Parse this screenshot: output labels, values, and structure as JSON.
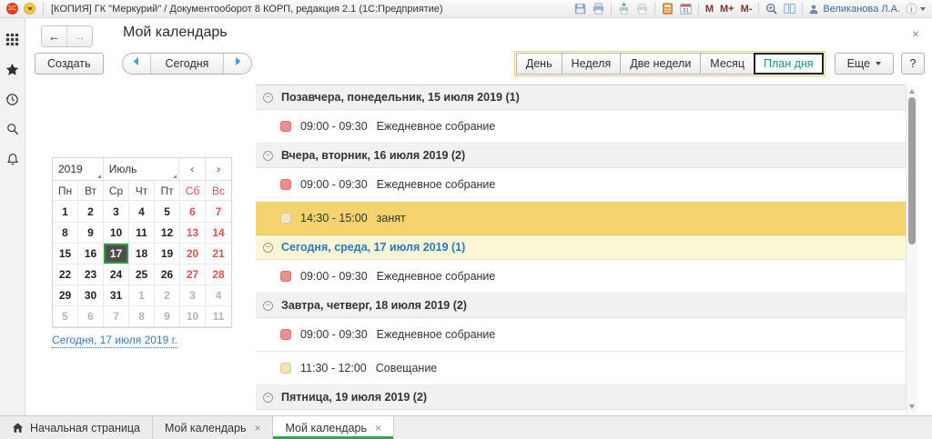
{
  "titlebar": {
    "title": "[КОПИЯ] ГК \"Меркурий\" / Документооборот 8 КОРП, редакция 2.1   (1С:Предприятие)",
    "user": "Великанова Л.А.",
    "tools": [
      {
        "name": "save-icon"
      },
      {
        "name": "print-icon"
      },
      {
        "name": "print-settings-icon"
      },
      {
        "name": "print-preview-icon"
      },
      {
        "name": "calculator-icon"
      },
      {
        "name": "calendar-icon"
      },
      {
        "name": "memory-recall-button",
        "label": "M"
      },
      {
        "name": "memory-plus-button",
        "label": "M+"
      },
      {
        "name": "memory-minus-button",
        "label": "M-"
      },
      {
        "name": "zoom-icon"
      },
      {
        "name": "split-view-icon"
      }
    ]
  },
  "sidebar": {
    "items": [
      {
        "name": "menu-grid-icon"
      },
      {
        "name": "favorites-star-icon"
      },
      {
        "name": "history-icon"
      },
      {
        "name": "search-icon"
      },
      {
        "name": "notifications-bell-icon"
      }
    ]
  },
  "header": {
    "title": "Мой календарь",
    "back": "←",
    "forward": "→",
    "close": "×"
  },
  "toolbar": {
    "create": "Создать",
    "today": "Сегодня",
    "views": [
      "День",
      "Неделя",
      "Две недели",
      "Месяц",
      "План дня"
    ],
    "active_view": "План дня",
    "more": "Еще",
    "help": "?"
  },
  "calendar": {
    "year": "2019",
    "month": "Июль",
    "prev": "‹",
    "next": "›",
    "weekdays": [
      {
        "l": "Пн",
        "w": false
      },
      {
        "l": "Вт",
        "w": false
      },
      {
        "l": "Ср",
        "w": false
      },
      {
        "l": "Чт",
        "w": false
      },
      {
        "l": "Пт",
        "w": false
      },
      {
        "l": "Сб",
        "w": true
      },
      {
        "l": "Вс",
        "w": true
      }
    ],
    "weeks": [
      [
        {
          "d": "1",
          "t": "n"
        },
        {
          "d": "2",
          "t": "n"
        },
        {
          "d": "3",
          "t": "n"
        },
        {
          "d": "4",
          "t": "n"
        },
        {
          "d": "5",
          "t": "n"
        },
        {
          "d": "6",
          "t": "w"
        },
        {
          "d": "7",
          "t": "w"
        }
      ],
      [
        {
          "d": "8",
          "t": "n"
        },
        {
          "d": "9",
          "t": "n"
        },
        {
          "d": "10",
          "t": "n"
        },
        {
          "d": "11",
          "t": "n"
        },
        {
          "d": "12",
          "t": "n"
        },
        {
          "d": "13",
          "t": "w"
        },
        {
          "d": "14",
          "t": "w"
        }
      ],
      [
        {
          "d": "15",
          "t": "n"
        },
        {
          "d": "16",
          "t": "n"
        },
        {
          "d": "17",
          "t": "s"
        },
        {
          "d": "18",
          "t": "n"
        },
        {
          "d": "19",
          "t": "n"
        },
        {
          "d": "20",
          "t": "w"
        },
        {
          "d": "21",
          "t": "w"
        }
      ],
      [
        {
          "d": "22",
          "t": "n"
        },
        {
          "d": "23",
          "t": "n"
        },
        {
          "d": "24",
          "t": "n"
        },
        {
          "d": "25",
          "t": "n"
        },
        {
          "d": "26",
          "t": "n"
        },
        {
          "d": "27",
          "t": "w"
        },
        {
          "d": "28",
          "t": "w"
        }
      ],
      [
        {
          "d": "29",
          "t": "n"
        },
        {
          "d": "30",
          "t": "n"
        },
        {
          "d": "31",
          "t": "n"
        },
        {
          "d": "1",
          "t": "m"
        },
        {
          "d": "2",
          "t": "m"
        },
        {
          "d": "3",
          "t": "m"
        },
        {
          "d": "4",
          "t": "m"
        }
      ],
      [
        {
          "d": "5",
          "t": "m"
        },
        {
          "d": "6",
          "t": "m"
        },
        {
          "d": "7",
          "t": "m"
        },
        {
          "d": "8",
          "t": "m"
        },
        {
          "d": "9",
          "t": "m"
        },
        {
          "d": "10",
          "t": "m"
        },
        {
          "d": "11",
          "t": "m"
        }
      ]
    ],
    "today_link": "Сегодня, 17 июля 2019 г."
  },
  "agenda": {
    "groups": [
      {
        "title": "Позавчера, понедельник, 15 июля 2019",
        "count": "1",
        "today": false,
        "events": [
          {
            "time": "09:00 - 09:30",
            "title": "Ежедневное собрание",
            "color": "#f18c8c",
            "selected": false
          }
        ]
      },
      {
        "title": "Вчера, вторник, 16 июля 2019",
        "count": "2",
        "today": false,
        "events": [
          {
            "time": "09:00 - 09:30",
            "title": "Ежедневное собрание",
            "color": "#f18c8c",
            "selected": false
          },
          {
            "time": "14:30 - 15:00",
            "title": "занят",
            "color": "#f1e6c9",
            "selected": true
          }
        ]
      },
      {
        "title": "Сегодня, среда, 17 июля 2019",
        "count": "1",
        "today": true,
        "events": [
          {
            "time": "09:00 - 09:30",
            "title": "Ежедневное собрание",
            "color": "#f18c8c",
            "selected": false
          }
        ]
      },
      {
        "title": "Завтра, четверг, 18 июля 2019",
        "count": "2",
        "today": false,
        "events": [
          {
            "time": "09:00 - 09:30",
            "title": "Ежедневное собрание",
            "color": "#f18c8c",
            "selected": false
          },
          {
            "time": "11:30 - 12:00",
            "title": "Совещание",
            "color": "#f2e3b6",
            "selected": false
          }
        ]
      },
      {
        "title": "Пятница, 19 июля 2019",
        "count": "2",
        "today": false,
        "events": []
      }
    ]
  },
  "tabs": [
    {
      "label": "Начальная страница",
      "icon": "home-icon",
      "closable": false,
      "active": false,
      "close": "×"
    },
    {
      "label": "Мой календарь",
      "closable": true,
      "active": false,
      "close": "×"
    },
    {
      "label": "Мой календарь",
      "closable": true,
      "active": true,
      "close": "×"
    }
  ],
  "colors": {
    "accent_green": "#2fa84f",
    "active_view_green": "#0b9f6e",
    "selection_gold": "#f5d36e",
    "today_row_bg": "#fbf7d5",
    "event_red": "#f18c8c",
    "link_blue": "#3b78bb",
    "weekend_red": "#e05252"
  }
}
